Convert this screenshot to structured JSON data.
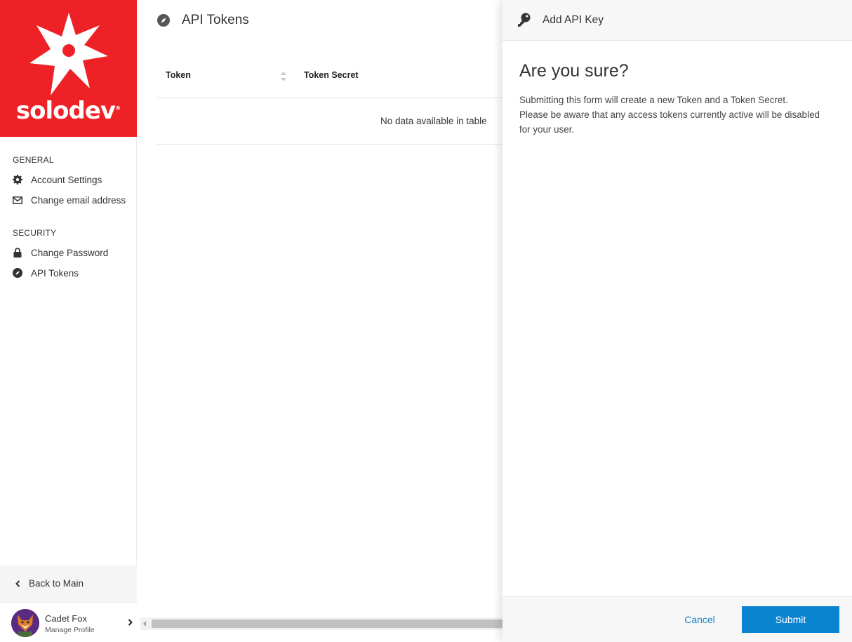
{
  "brand": {
    "name": "solodev",
    "registered_mark": "®",
    "color": "#ee2127"
  },
  "sidebar": {
    "sections": [
      {
        "title": "GENERAL",
        "items": [
          {
            "label": "Account Settings",
            "icon": "gear-icon"
          },
          {
            "label": "Change email address",
            "icon": "envelope-icon"
          }
        ]
      },
      {
        "title": "SECURITY",
        "items": [
          {
            "label": "Change Password",
            "icon": "lock-icon"
          },
          {
            "label": "API Tokens",
            "icon": "compass-icon"
          }
        ]
      }
    ],
    "back_label": "Back to Main",
    "profile": {
      "name": "Cadet Fox",
      "subtitle": "Manage Profile"
    }
  },
  "main": {
    "title": "API Tokens",
    "title_icon": "compass-icon",
    "table": {
      "columns": [
        "Token",
        "Token Secret"
      ],
      "empty_message": "No data available in table"
    }
  },
  "panel": {
    "title": "Add API Key",
    "title_icon": "key-icon",
    "heading": "Are you sure?",
    "body_lines": [
      "Submitting this form will create a new Token and a Token Secret.",
      "Please be aware that any access tokens currently active will be disabled",
      "for your user."
    ],
    "cancel_label": "Cancel",
    "submit_label": "Submit",
    "accent_color": "#0a84d0"
  }
}
